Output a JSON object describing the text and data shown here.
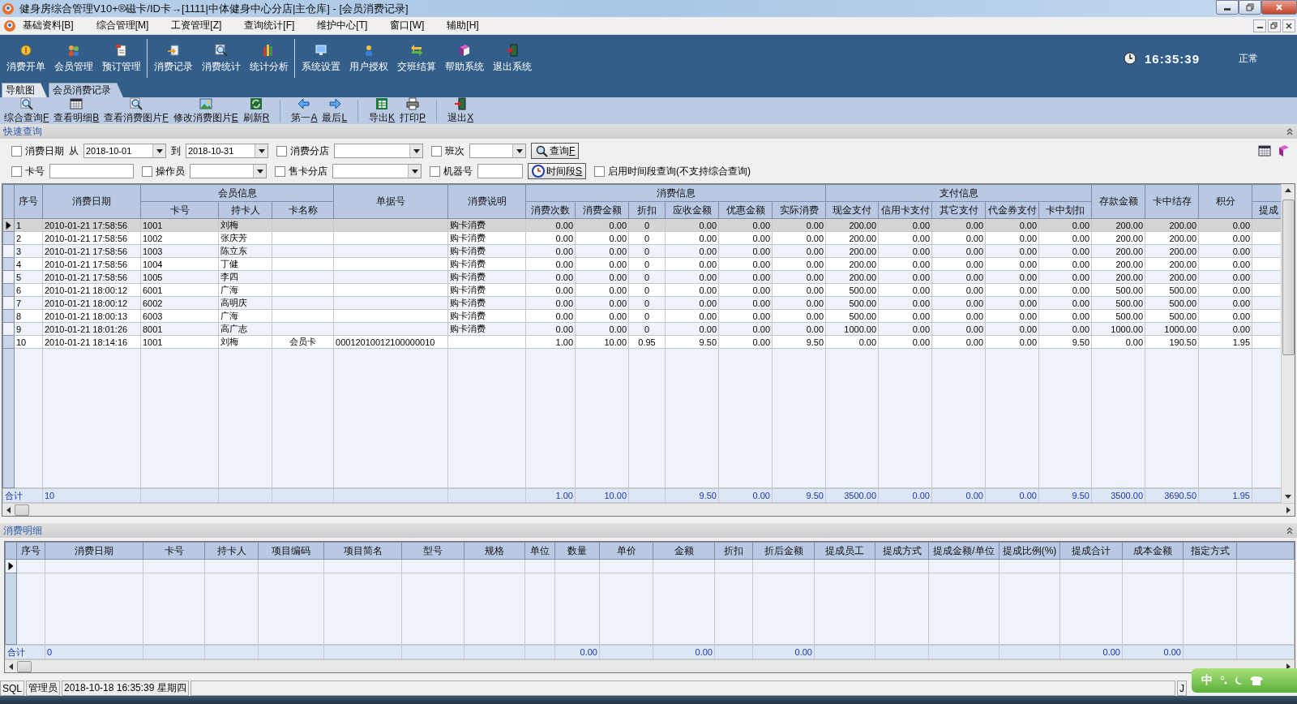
{
  "window": {
    "title": "健身房综合管理V10+®磁卡/ID卡→[1111|中体健身中心分店|主仓库] - [会员消费记录]"
  },
  "menu": [
    "基础资料[B]",
    "综合管理[M]",
    "工资管理[Z]",
    "查询统计[F]",
    "维护中心[T]",
    "窗口[W]",
    "辅助[H]"
  ],
  "toolbar": [
    {
      "items": [
        "消费开单",
        "会员管理",
        "预订管理"
      ]
    },
    {
      "items": [
        "消费记录",
        "消费统计",
        "统计分析"
      ]
    },
    {
      "items": [
        "系统设置",
        "用户授权",
        "交班结算",
        "帮助系统",
        "退出系统"
      ]
    }
  ],
  "clock": "16:35:39",
  "status": "正常",
  "tabs": [
    {
      "label": "导航图",
      "selected": false
    },
    {
      "label": "会员消费记录",
      "selected": true
    }
  ],
  "actions": [
    {
      "items": [
        {
          "label": "综合查询",
          "key": "F"
        },
        {
          "label": "查看明细",
          "key": "B"
        },
        {
          "label": "查看消费图片",
          "key": "F"
        },
        {
          "label": "修改消费图片",
          "key": "E"
        },
        {
          "label": "刷新",
          "key": "R"
        }
      ]
    },
    {
      "items": [
        {
          "label": "第一",
          "key": "A"
        },
        {
          "label": "最后",
          "key": "L"
        }
      ]
    },
    {
      "items": [
        {
          "label": "导出",
          "key": "K"
        },
        {
          "label": "打印",
          "key": "P"
        }
      ]
    },
    {
      "items": [
        {
          "label": "退出",
          "key": "X"
        }
      ]
    }
  ],
  "quick_query": {
    "title": "快速查询",
    "rows": [
      {
        "items": [
          {
            "kind": "check",
            "label": "消费日期",
            "checked": false
          },
          {
            "kind": "label",
            "label": "从"
          },
          {
            "kind": "date",
            "value": "2018-10-01"
          },
          {
            "kind": "label",
            "label": "到"
          },
          {
            "kind": "date",
            "value": "2018-10-31"
          },
          {
            "kind": "check",
            "label": "消费分店",
            "checked": false
          },
          {
            "kind": "select"
          },
          {
            "kind": "check",
            "label": "班次",
            "checked": false
          },
          {
            "kind": "select-narrow"
          },
          {
            "kind": "button",
            "label": "查询",
            "key": "F"
          }
        ]
      },
      {
        "items": [
          {
            "kind": "check",
            "label": "卡号",
            "checked": false
          },
          {
            "kind": "input"
          },
          {
            "kind": "check",
            "label": "操作员",
            "checked": false
          },
          {
            "kind": "select-short"
          },
          {
            "kind": "check",
            "label": "售卡分店",
            "checked": false
          },
          {
            "kind": "select"
          },
          {
            "kind": "check",
            "label": "机器号",
            "checked": false
          },
          {
            "kind": "input-narrow"
          },
          {
            "kind": "button",
            "label": "时间段",
            "key": "S"
          },
          {
            "kind": "check",
            "label": "启用时间段查询(不支持综合查询)",
            "checked": false
          }
        ]
      }
    ]
  },
  "main_table": {
    "header": [
      {
        "label": "序号",
        "kind": "text"
      },
      {
        "label": "消费日期",
        "kind": "text"
      },
      {
        "label": "会员信息",
        "columns": [
          {
            "label": "卡号",
            "kind": "text"
          },
          {
            "label": "持卡人",
            "kind": "text"
          },
          {
            "label": "卡名称",
            "kind": "center"
          }
        ]
      },
      {
        "label": "单据号",
        "kind": "text"
      },
      {
        "label": "消费说明",
        "kind": "text"
      },
      {
        "label": "消费信息",
        "columns": [
          {
            "label": "消费次数",
            "kind": "number",
            "total": "1.00"
          },
          {
            "label": "消费金额",
            "kind": "number",
            "total": "10.00"
          },
          {
            "label": "折扣",
            "kind": "center"
          },
          {
            "label": "应收金额",
            "kind": "number",
            "total": "9.50"
          },
          {
            "label": "优惠金额",
            "kind": "number",
            "total": "0.00"
          },
          {
            "label": "实际消费",
            "kind": "number",
            "total": "9.50"
          }
        ]
      },
      {
        "label": "支付信息",
        "columns": [
          {
            "label": "现金支付",
            "kind": "number",
            "total": "3500.00"
          },
          {
            "label": "信用卡支付",
            "kind": "number",
            "total": "0.00"
          },
          {
            "label": "其它支付",
            "kind": "number",
            "total": "0.00"
          },
          {
            "label": "代金券支付",
            "kind": "number",
            "total": "0.00"
          },
          {
            "label": "卡中划扣",
            "kind": "number",
            "total": "9.50"
          }
        ]
      },
      {
        "label": "存款金额",
        "kind": "number",
        "total": "3500.00"
      },
      {
        "label": "卡中结存",
        "kind": "number",
        "total": "3690.50"
      },
      {
        "label": "积分",
        "kind": "number",
        "total": "1.95"
      },
      {
        "columns": [
          {
            "label": "提成",
            "kind": "text"
          }
        ]
      }
    ],
    "rows": [
      {
        "selected": true,
        "cells": [
          "1",
          "2010-01-21 17:58:56",
          "1001",
          "刘梅",
          null,
          null,
          "购卡消费",
          "0.00",
          "0.00",
          "0",
          "0.00",
          "0.00",
          "0.00",
          "200.00",
          "0.00",
          "0.00",
          "0.00",
          "0.00",
          "200.00",
          "200.00",
          "0.00",
          null
        ]
      },
      {
        "selected": false,
        "cells": [
          "2",
          "2010-01-21 17:58:56",
          "1002",
          "张庆芳",
          null,
          null,
          "购卡消费",
          "0.00",
          "0.00",
          "0",
          "0.00",
          "0.00",
          "0.00",
          "200.00",
          "0.00",
          "0.00",
          "0.00",
          "0.00",
          "200.00",
          "200.00",
          "0.00",
          null
        ]
      },
      {
        "selected": false,
        "cells": [
          "3",
          "2010-01-21 17:58:56",
          "1003",
          "陈立东",
          null,
          null,
          "购卡消费",
          "0.00",
          "0.00",
          "0",
          "0.00",
          "0.00",
          "0.00",
          "200.00",
          "0.00",
          "0.00",
          "0.00",
          "0.00",
          "200.00",
          "200.00",
          "0.00",
          null
        ]
      },
      {
        "selected": false,
        "cells": [
          "4",
          "2010-01-21 17:58:56",
          "1004",
          "丁健",
          null,
          null,
          "购卡消费",
          "0.00",
          "0.00",
          "0",
          "0.00",
          "0.00",
          "0.00",
          "200.00",
          "0.00",
          "0.00",
          "0.00",
          "0.00",
          "200.00",
          "200.00",
          "0.00",
          null
        ]
      },
      {
        "selected": false,
        "cells": [
          "5",
          "2010-01-21 17:58:56",
          "1005",
          "李四",
          null,
          null,
          "购卡消费",
          "0.00",
          "0.00",
          "0",
          "0.00",
          "0.00",
          "0.00",
          "200.00",
          "0.00",
          "0.00",
          "0.00",
          "0.00",
          "200.00",
          "200.00",
          "0.00",
          null
        ]
      },
      {
        "selected": false,
        "cells": [
          "6",
          "2010-01-21 18:00:12",
          "6001",
          "广海",
          null,
          null,
          "购卡消费",
          "0.00",
          "0.00",
          "0",
          "0.00",
          "0.00",
          "0.00",
          "500.00",
          "0.00",
          "0.00",
          "0.00",
          "0.00",
          "500.00",
          "500.00",
          "0.00",
          null
        ]
      },
      {
        "selected": false,
        "cells": [
          "7",
          "2010-01-21 18:00:12",
          "6002",
          "高明庆",
          null,
          null,
          "购卡消费",
          "0.00",
          "0.00",
          "0",
          "0.00",
          "0.00",
          "0.00",
          "500.00",
          "0.00",
          "0.00",
          "0.00",
          "0.00",
          "500.00",
          "500.00",
          "0.00",
          null
        ]
      },
      {
        "selected": false,
        "cells": [
          "8",
          "2010-01-21 18:00:13",
          "6003",
          "广海",
          null,
          null,
          "购卡消费",
          "0.00",
          "0.00",
          "0",
          "0.00",
          "0.00",
          "0.00",
          "500.00",
          "0.00",
          "0.00",
          "0.00",
          "0.00",
          "500.00",
          "500.00",
          "0.00",
          null
        ]
      },
      {
        "selected": false,
        "cells": [
          "9",
          "2010-01-21 18:01:26",
          "8001",
          "高广志",
          null,
          null,
          "购卡消费",
          "0.00",
          "0.00",
          "0",
          "0.00",
          "0.00",
          "0.00",
          "1000.00",
          "0.00",
          "0.00",
          "0.00",
          "0.00",
          "1000.00",
          "1000.00",
          "0.00",
          null
        ]
      },
      {
        "selected": false,
        "cells": [
          "10",
          "2010-01-21 18:14:16",
          "1001",
          "刘梅",
          "会员卡",
          "00012010012100000010",
          null,
          "1.00",
          "10.00",
          "0.95",
          "9.50",
          "0.00",
          "9.50",
          "0.00",
          "0.00",
          "0.00",
          "0.00",
          "9.50",
          "0.00",
          "190.50",
          "1.95",
          null
        ]
      }
    ],
    "total": {
      "label": "合计",
      "count": "10"
    }
  },
  "detail": {
    "title": "消费明细",
    "columns": [
      {
        "label": "序号"
      },
      {
        "label": "消费日期"
      },
      {
        "label": "卡号"
      },
      {
        "label": "持卡人"
      },
      {
        "label": "项目编码"
      },
      {
        "label": "项目简名"
      },
      {
        "label": "型号"
      },
      {
        "label": "规格"
      },
      {
        "label": "单位"
      },
      {
        "label": "数量",
        "total": "0.00"
      },
      {
        "label": "单价"
      },
      {
        "label": "金额",
        "total": "0.00"
      },
      {
        "label": "折扣"
      },
      {
        "label": "折后金额",
        "total": "0.00"
      },
      {
        "label": "提成员工"
      },
      {
        "label": "提成方式"
      },
      {
        "label": "提成金额/单位"
      },
      {
        "label": "提成比例(%)"
      },
      {
        "label": "提成合计",
        "total": "0.00"
      },
      {
        "label": "成本金额",
        "total": "0.00"
      },
      {
        "label": "指定方式"
      }
    ],
    "total": {
      "label": "合计",
      "count": "0"
    }
  },
  "status_bar": [
    "SQL",
    "管理员",
    "2018-10-18 16:35:39 星期四",
    "J"
  ],
  "ime": {
    "mode": "中"
  }
}
